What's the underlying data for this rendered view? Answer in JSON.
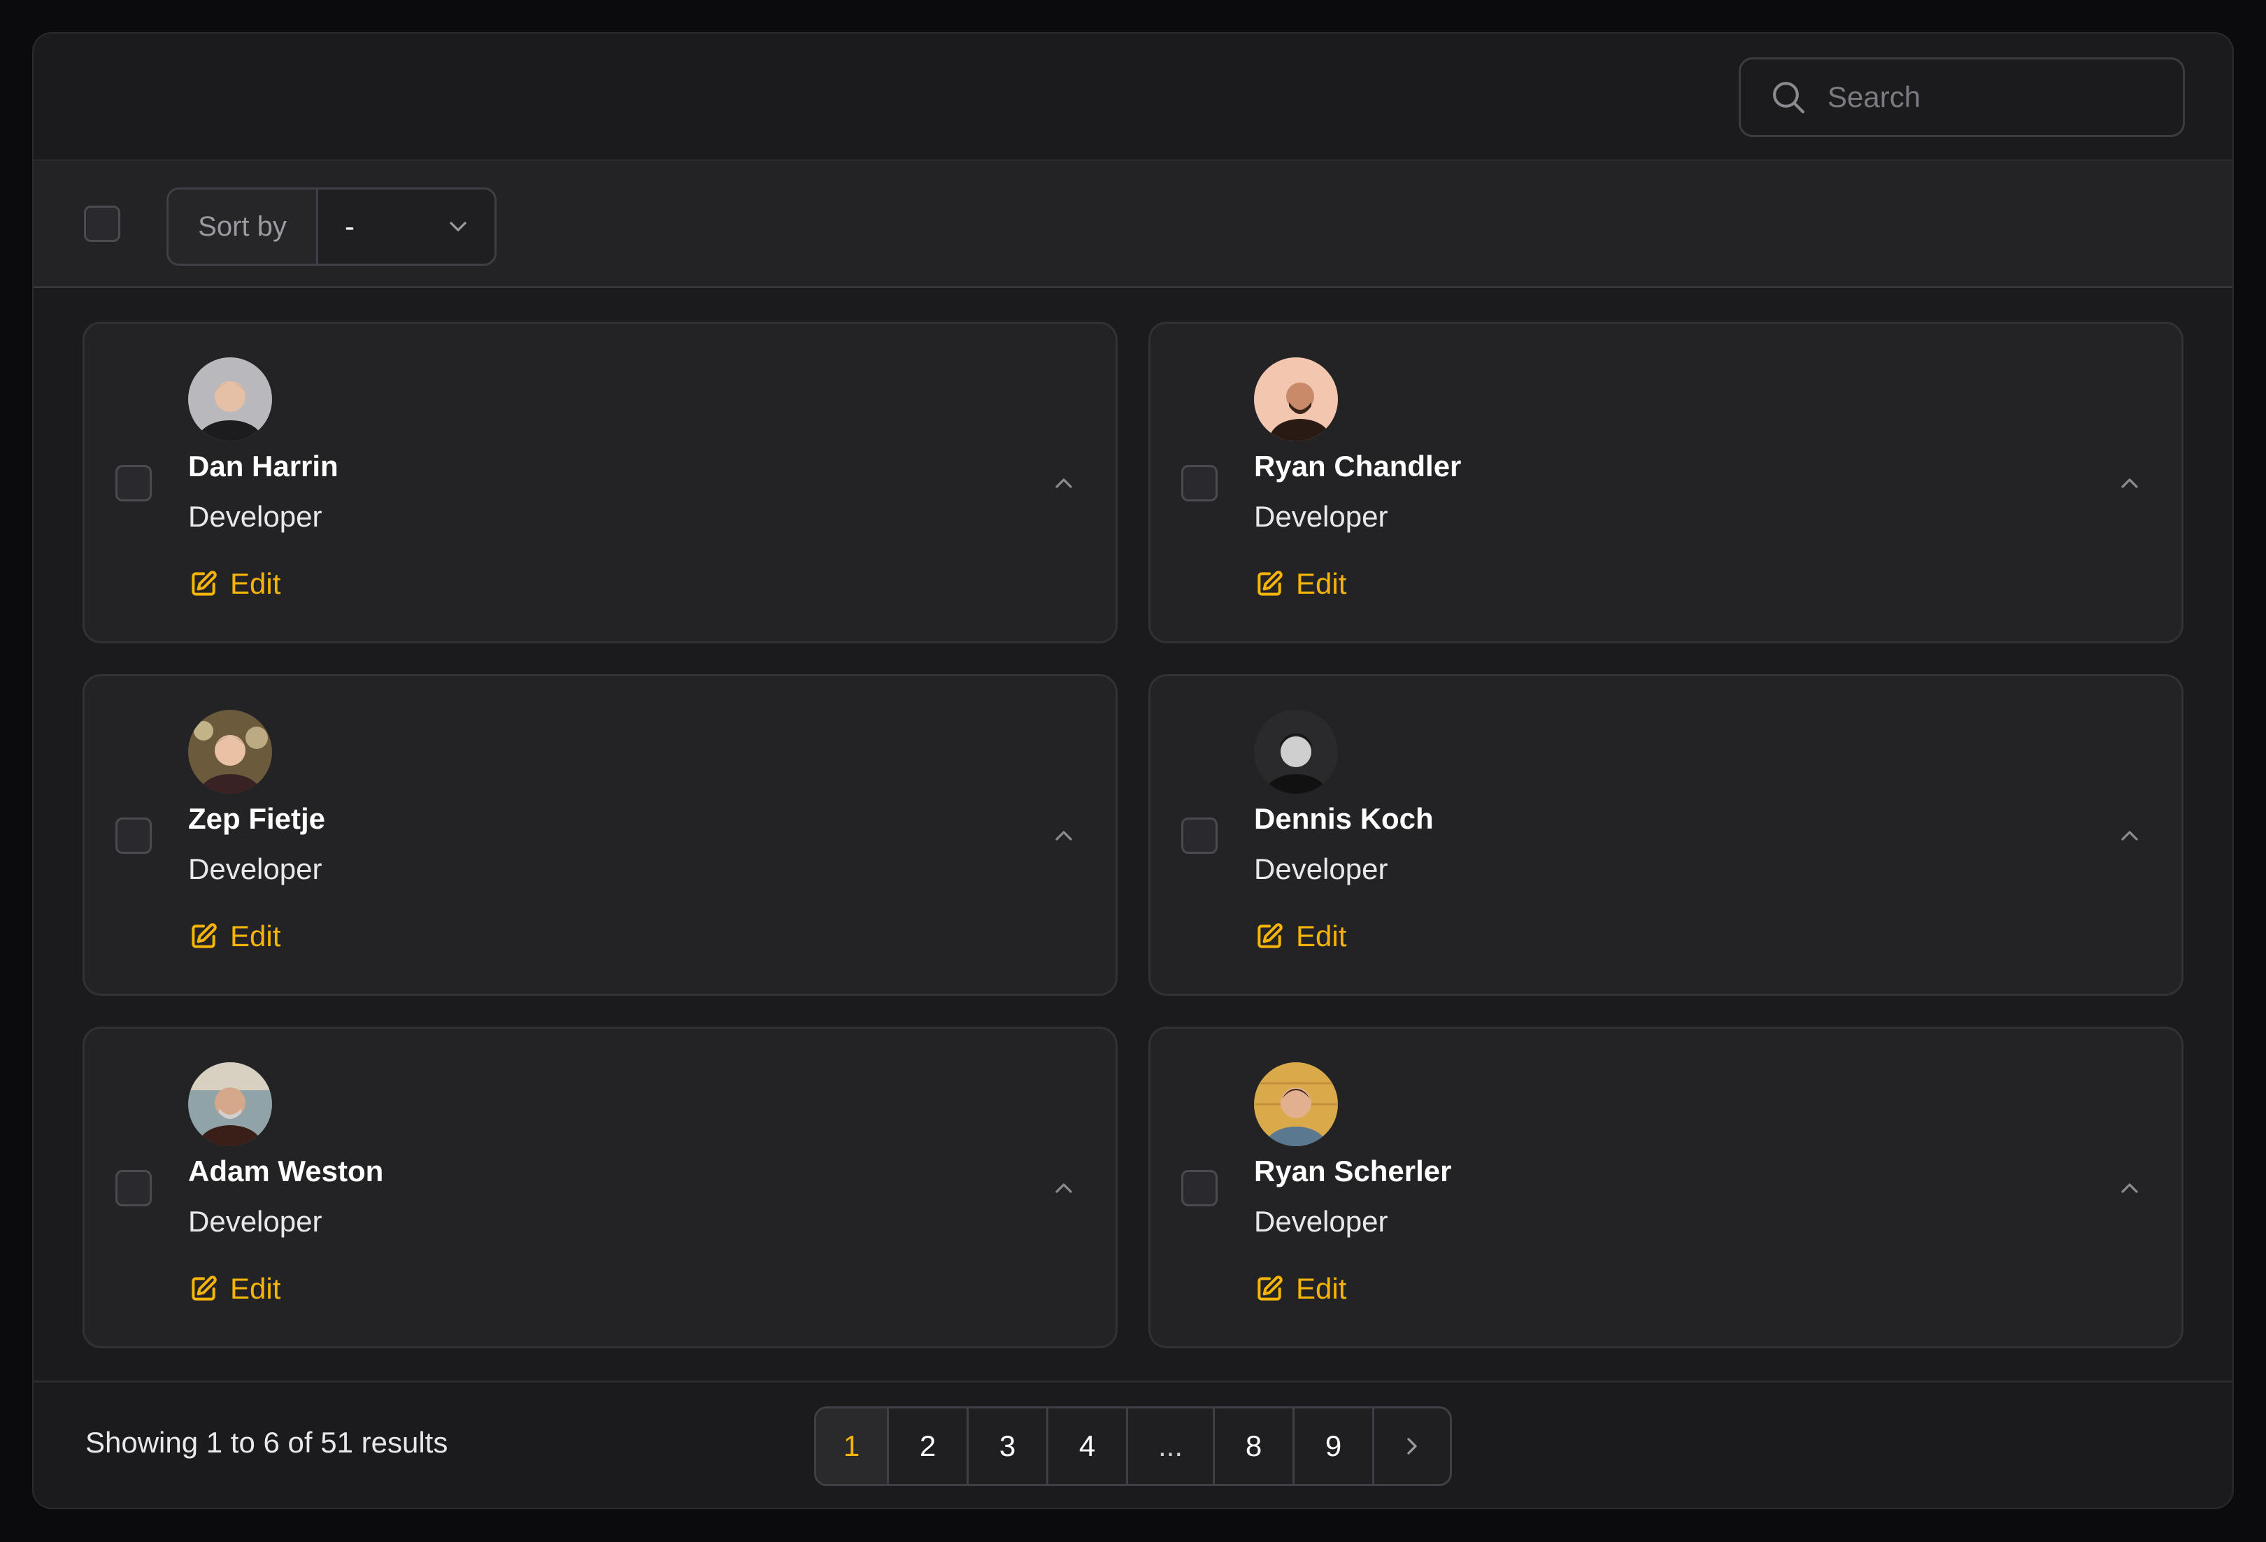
{
  "search": {
    "placeholder": "Search"
  },
  "toolbar": {
    "sort_label": "Sort by",
    "sort_value": "-"
  },
  "cards": [
    {
      "name": "Dan Harrin",
      "role": "Developer",
      "edit_label": "Edit"
    },
    {
      "name": "Ryan Chandler",
      "role": "Developer",
      "edit_label": "Edit"
    },
    {
      "name": "Zep Fietje",
      "role": "Developer",
      "edit_label": "Edit"
    },
    {
      "name": "Dennis Koch",
      "role": "Developer",
      "edit_label": "Edit"
    },
    {
      "name": "Adam Weston",
      "role": "Developer",
      "edit_label": "Edit"
    },
    {
      "name": "Ryan Scherler",
      "role": "Developer",
      "edit_label": "Edit"
    }
  ],
  "footer": {
    "results_text": "Showing 1 to 6 of 51 results",
    "pages": [
      "1",
      "2",
      "3",
      "4",
      "...",
      "8",
      "9"
    ],
    "current_page": "1"
  },
  "colors": {
    "accent": "#f5b40a",
    "background": "#1b1b1e",
    "card": "#232326"
  },
  "icons": [
    "search-icon",
    "chevron-down-icon",
    "pencil-square-icon",
    "chevron-up-icon",
    "chevron-right-icon"
  ]
}
